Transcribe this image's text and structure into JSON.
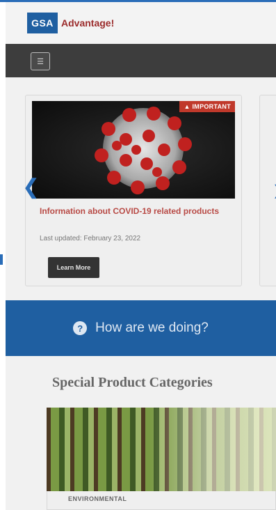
{
  "header": {
    "logo_abbr": "GSA",
    "logo_text": "Advantage!"
  },
  "nav": {
    "menu_icon": "hamburger-icon"
  },
  "carousel": {
    "badge": "IMPORTANT",
    "title": "Information about COVID-19 related products",
    "updated": "Last updated: February 23, 2022",
    "button": "Learn More",
    "prev_icon": "chevron-left-icon",
    "next_icon": "chevron-right-icon"
  },
  "feedback": {
    "icon": "help-circle-icon",
    "label": "How are we doing?"
  },
  "categories": {
    "heading": "Special Product Categories",
    "card_label": "ENVIRONMENTAL"
  },
  "colors": {
    "brand_blue": "#1f5fa1",
    "brand_red": "#9b2b2b",
    "nav_dark": "#3d3d3d"
  }
}
